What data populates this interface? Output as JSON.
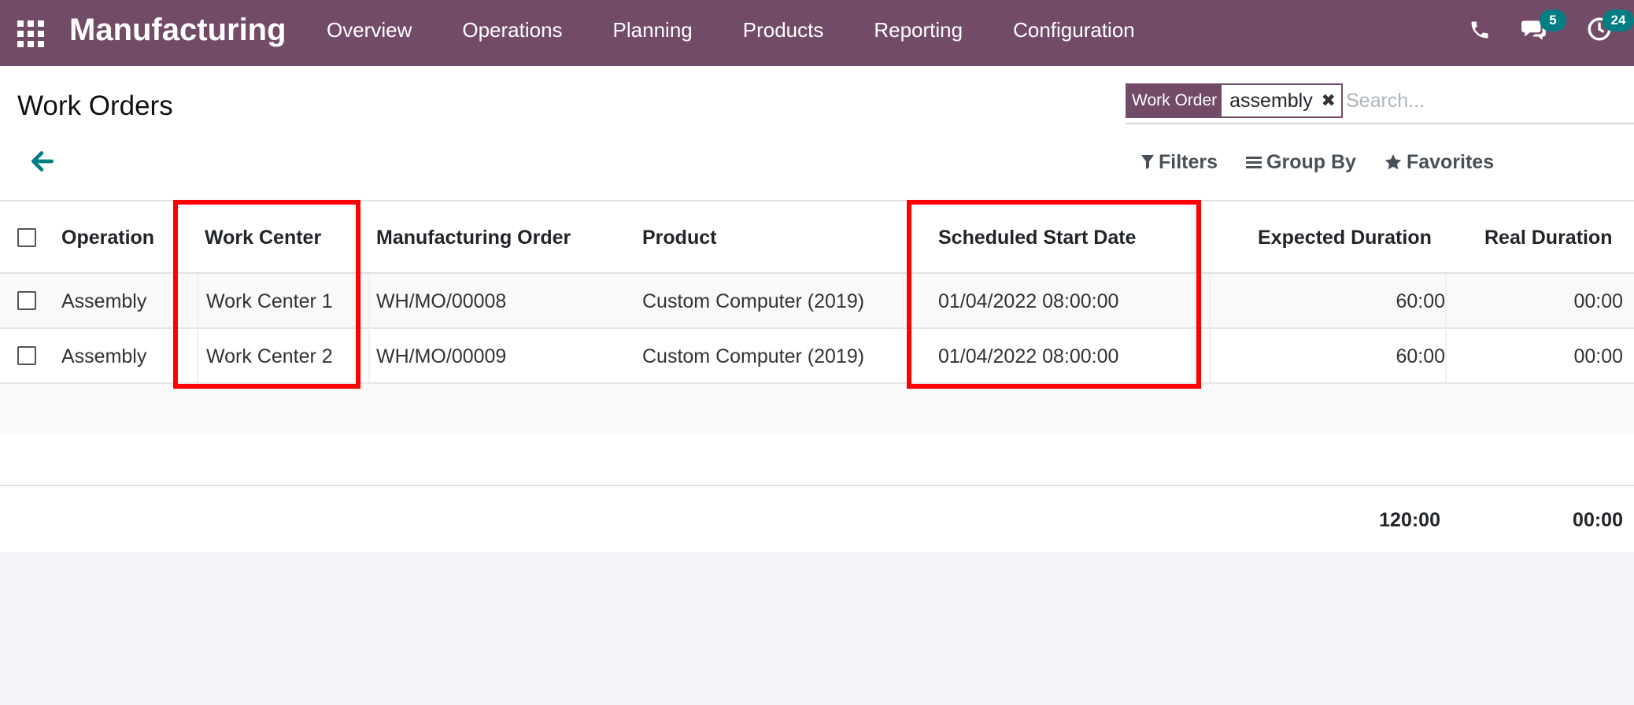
{
  "app": {
    "name": "Manufacturing",
    "menu": [
      "Overview",
      "Operations",
      "Planning",
      "Products",
      "Reporting",
      "Configuration"
    ],
    "chat_badge": "5",
    "activity_badge": "24",
    "colors": {
      "navbar": "#714b67",
      "badge": "#017e84",
      "highlight": "#ff0000"
    }
  },
  "page": {
    "title": "Work Orders"
  },
  "search": {
    "facet_label": "Work Order",
    "facet_value": "assembly",
    "placeholder": "Search...",
    "filters_label": "Filters",
    "group_by_label": "Group By",
    "favorites_label": "Favorites"
  },
  "table": {
    "columns": [
      "Operation",
      "Work Center",
      "Manufacturing Order",
      "Product",
      "Scheduled Start Date",
      "Expected Duration",
      "Real Duration"
    ],
    "rows": [
      {
        "operation": "Assembly",
        "work_center": "Work Center 1",
        "mo": "WH/MO/00008",
        "product": "Custom Computer (2019)",
        "start": "01/04/2022 08:00:00",
        "expected": "60:00",
        "real": "00:00"
      },
      {
        "operation": "Assembly",
        "work_center": "Work Center 2",
        "mo": "WH/MO/00009",
        "product": "Custom Computer (2019)",
        "start": "01/04/2022 08:00:00",
        "expected": "60:00",
        "real": "00:00"
      }
    ],
    "totals": {
      "expected": "120:00",
      "real": "00:00"
    }
  }
}
